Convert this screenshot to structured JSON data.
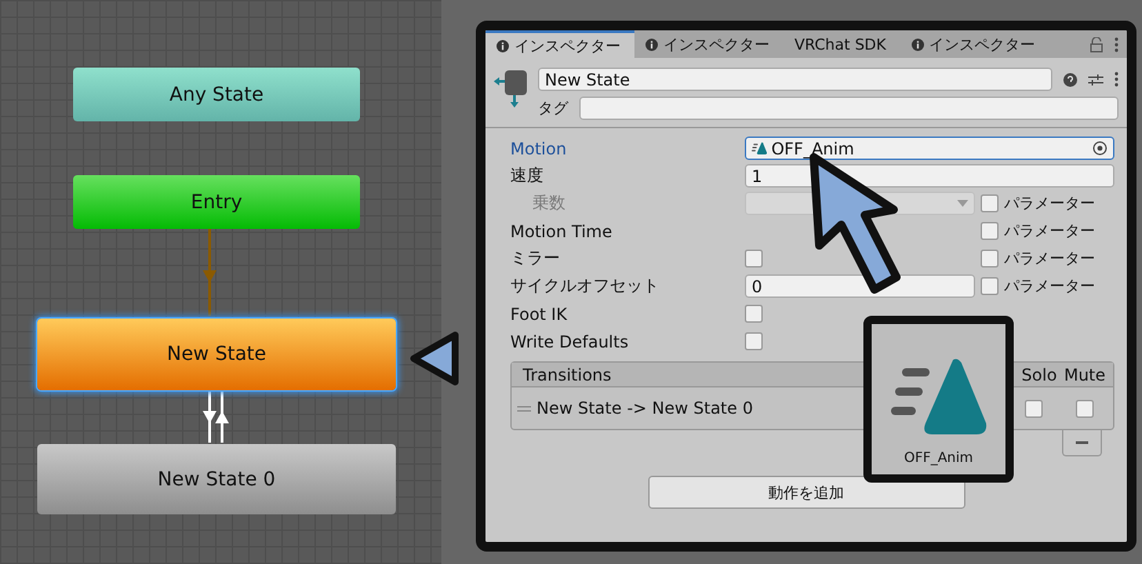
{
  "graph": {
    "nodes": [
      {
        "label": "Any State",
        "kind": "any",
        "selected": false
      },
      {
        "label": "Entry",
        "kind": "entry",
        "selected": false
      },
      {
        "label": "New State",
        "kind": "default",
        "selected": true
      },
      {
        "label": "New State 0",
        "kind": "state",
        "selected": false
      }
    ]
  },
  "inspector": {
    "tabs": [
      {
        "label": "インスペクター",
        "info_icon": true,
        "selected": true
      },
      {
        "label": "インスペクター",
        "info_icon": true,
        "selected": false
      },
      {
        "label": "VRChat SDK",
        "info_icon": false,
        "selected": false
      },
      {
        "label": "インスペクター",
        "info_icon": true,
        "selected": false
      }
    ],
    "header": {
      "name": "New State",
      "tag_label": "タグ"
    },
    "properties": [
      {
        "label": "Motion",
        "kind": "object",
        "value": "OFF_Anim",
        "highlighted": true,
        "disabled": false
      },
      {
        "label": "速度",
        "kind": "text",
        "value": "1",
        "highlighted": false,
        "disabled": false
      },
      {
        "label": "乗数",
        "kind": "dropdown",
        "highlighted": false,
        "disabled": true,
        "parameter": {
          "label": "パラメーター",
          "checked": false
        }
      },
      {
        "label": "Motion Time",
        "kind": "none",
        "highlighted": false,
        "disabled": false,
        "parameter": {
          "label": "パラメーター",
          "checked": false
        }
      },
      {
        "label": "ミラー",
        "kind": "checkbox",
        "checked": false,
        "highlighted": false,
        "disabled": false,
        "parameter": {
          "label": "パラメーター",
          "checked": false
        }
      },
      {
        "label": "サイクルオフセット",
        "kind": "short_text",
        "value": "0",
        "highlighted": false,
        "disabled": false,
        "parameter": {
          "label": "パラメーター",
          "checked": false
        }
      },
      {
        "label": "Foot IK",
        "kind": "checkbox",
        "checked": false,
        "highlighted": false,
        "disabled": false
      },
      {
        "label": "Write Defaults",
        "kind": "checkbox",
        "checked": false,
        "highlighted": false,
        "disabled": false
      }
    ],
    "transitions": {
      "title": "Transitions",
      "solo_label": "Solo",
      "mute_label": "Mute",
      "rows": [
        {
          "label": "New State -> New State 0",
          "solo": false,
          "mute": false
        }
      ]
    },
    "add_button": "動作を追加"
  },
  "preview": {
    "label": "OFF_Anim"
  }
}
